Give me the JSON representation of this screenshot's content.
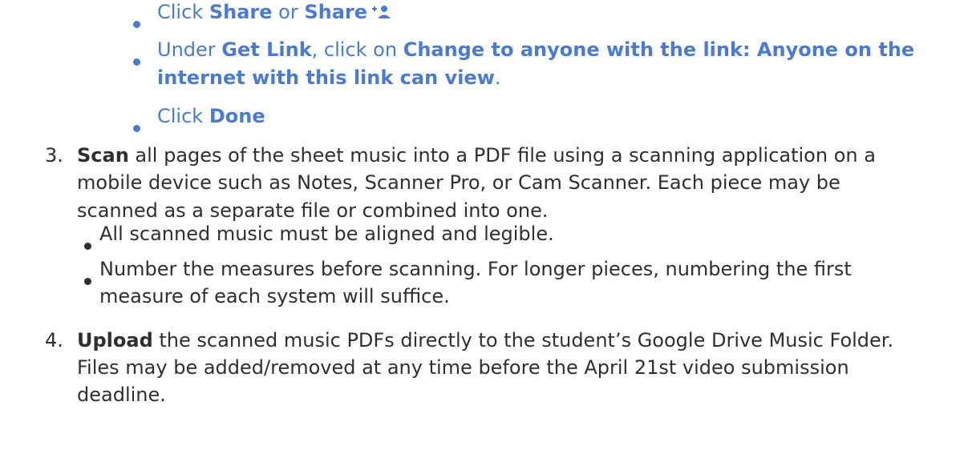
{
  "sub_steps": {
    "share": {
      "prefix": "Click ",
      "share_bold": "Share",
      "or": " or ",
      "share_bold_2": "Share",
      "icon": "person-add-icon"
    },
    "get_link": {
      "prefix": "Under ",
      "get_link_bold": "Get Link",
      "middle": ", click on ",
      "change_bold_1": "Change to anyone with the link: Anyone on the",
      "change_bold_2": "internet with this link can view",
      "end": "."
    },
    "done": {
      "prefix": "Click ",
      "done_bold": "Done"
    }
  },
  "step3": {
    "number": "3.",
    "scan_bold": "Scan",
    "line1_rest": " all pages of the sheet music into a PDF file using a scanning application on a",
    "line2": "mobile device such as Notes, Scanner Pro, or Cam Scanner. Each piece may be",
    "line3": "scanned as a separate file or combined into one.",
    "bullets": {
      "b1": "All scanned music must be aligned and legible.",
      "b2_line1": "Number the measures before scanning. For longer pieces, numbering the first",
      "b2_line2": "measure of each system will suffice."
    }
  },
  "step4": {
    "number": "4.",
    "upload_bold": "Upload",
    "line1_rest": " the scanned music PDFs directly to the student’s Google Drive Music Folder.",
    "line2": "Files may be added/removed at any time before the April 21st video submission",
    "line3": "deadline."
  },
  "colors": {
    "link_blue": "#4a7bd0",
    "body_text": "#2f2f2f"
  }
}
